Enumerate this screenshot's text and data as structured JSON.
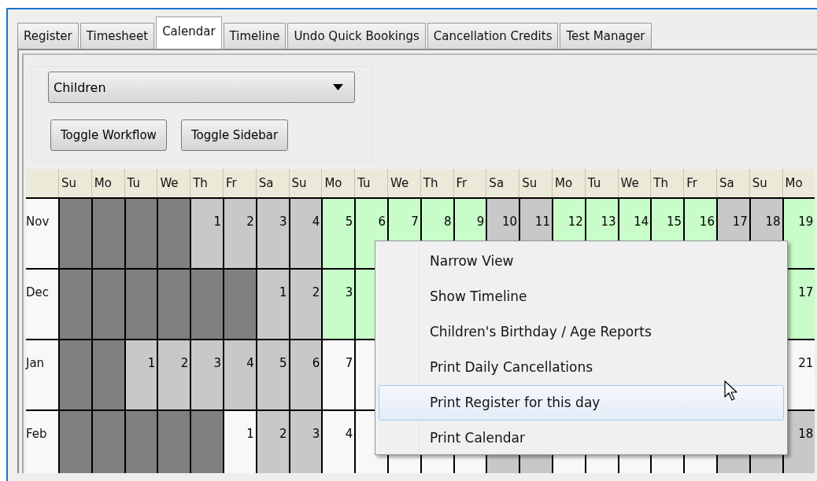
{
  "tabs": [
    {
      "label": "Register",
      "selected": false
    },
    {
      "label": "Timesheet",
      "selected": false
    },
    {
      "label": "Calendar",
      "selected": true
    },
    {
      "label": "Timeline",
      "selected": false
    },
    {
      "label": "Undo Quick Bookings",
      "selected": false
    },
    {
      "label": "Cancellation Credits",
      "selected": false
    },
    {
      "label": "Test Manager",
      "selected": false
    }
  ],
  "dropdown": {
    "value": "Children"
  },
  "buttons": [
    "Toggle Workflow",
    "Toggle Sidebar"
  ],
  "calendar": {
    "weekdays": [
      "Su",
      "Mo",
      "Tu",
      "We",
      "Th",
      "Fr",
      "Sa",
      "Su",
      "Mo",
      "Tu",
      "We",
      "Th",
      "Fr",
      "Sa",
      "Su",
      "Mo",
      "Tu",
      "We",
      "Th",
      "Fr",
      "Sa",
      "Su",
      "Mo"
    ],
    "months": [
      {
        "label": "Nov",
        "cells": [
          {
            "kind": "outside"
          },
          {
            "kind": "outside"
          },
          {
            "kind": "outside"
          },
          {
            "kind": "outside"
          },
          {
            "kind": "closed",
            "day": "1"
          },
          {
            "kind": "closed",
            "day": "2"
          },
          {
            "kind": "closed",
            "day": "3"
          },
          {
            "kind": "closed",
            "day": "4"
          },
          {
            "kind": "booked",
            "day": "5"
          },
          {
            "kind": "booked",
            "day": "6"
          },
          {
            "kind": "booked",
            "day": "7"
          },
          {
            "kind": "booked",
            "day": "8"
          },
          {
            "kind": "booked",
            "day": "9"
          },
          {
            "kind": "closed",
            "day": "10"
          },
          {
            "kind": "closed",
            "day": "11"
          },
          {
            "kind": "booked",
            "day": "12"
          },
          {
            "kind": "booked",
            "day": "13"
          },
          {
            "kind": "booked",
            "day": "14"
          },
          {
            "kind": "booked",
            "day": "15"
          },
          {
            "kind": "booked",
            "day": "16"
          },
          {
            "kind": "closed",
            "day": "17"
          },
          {
            "kind": "closed",
            "day": "18"
          },
          {
            "kind": "booked",
            "day": "19"
          }
        ]
      },
      {
        "label": "Dec",
        "cells": [
          {
            "kind": "outside"
          },
          {
            "kind": "outside"
          },
          {
            "kind": "outside"
          },
          {
            "kind": "outside"
          },
          {
            "kind": "outside"
          },
          {
            "kind": "outside"
          },
          {
            "kind": "closed",
            "day": "1"
          },
          {
            "kind": "closed",
            "day": "2"
          },
          {
            "kind": "booked",
            "day": "3"
          },
          {
            "kind": "booked"
          },
          null,
          null,
          null,
          null,
          null,
          null,
          null,
          null,
          null,
          null,
          null,
          null,
          {
            "kind": "booked",
            "day": "17"
          }
        ]
      },
      {
        "label": "Jan",
        "cells": [
          {
            "kind": "outside"
          },
          {
            "kind": "outside"
          },
          {
            "kind": "closed",
            "day": "1"
          },
          {
            "kind": "closed",
            "day": "2"
          },
          {
            "kind": "closed",
            "day": "3"
          },
          {
            "kind": "closed",
            "day": "4"
          },
          {
            "kind": "closed",
            "day": "5"
          },
          {
            "kind": "closed",
            "day": "6"
          },
          {
            "kind": "open",
            "day": "7"
          },
          {
            "kind": "open"
          },
          null,
          null,
          null,
          null,
          null,
          null,
          null,
          null,
          null,
          null,
          null,
          null,
          {
            "kind": "open",
            "day": "21"
          }
        ]
      },
      {
        "label": "Feb",
        "cells": [
          {
            "kind": "outside"
          },
          {
            "kind": "outside"
          },
          {
            "kind": "outside"
          },
          {
            "kind": "outside"
          },
          {
            "kind": "outside"
          },
          {
            "kind": "open",
            "day": "1"
          },
          {
            "kind": "closed",
            "day": "2"
          },
          {
            "kind": "closed",
            "day": "3"
          },
          {
            "kind": "open",
            "day": "4"
          },
          {
            "kind": "open"
          },
          {
            "kind": "open"
          },
          {
            "kind": "open"
          },
          {
            "kind": "open"
          },
          {
            "kind": "closed"
          },
          {
            "kind": "closed"
          },
          {
            "kind": "open"
          },
          {
            "kind": "open"
          },
          {
            "kind": "open"
          },
          {
            "kind": "open"
          },
          {
            "kind": "open"
          },
          {
            "kind": "closed"
          },
          {
            "kind": "closed"
          },
          {
            "kind": "closed",
            "day": "18"
          }
        ]
      }
    ]
  },
  "context_menu": {
    "items": [
      {
        "label": "Narrow View",
        "highlighted": false
      },
      {
        "label": "Show Timeline",
        "highlighted": false
      },
      {
        "label": "Children's Birthday / Age Reports",
        "highlighted": false
      },
      {
        "label": "Print Daily Cancellations",
        "highlighted": false
      },
      {
        "label": "Print Register for this day",
        "highlighted": true
      },
      {
        "label": "Print Calendar",
        "highlighted": false
      }
    ]
  }
}
